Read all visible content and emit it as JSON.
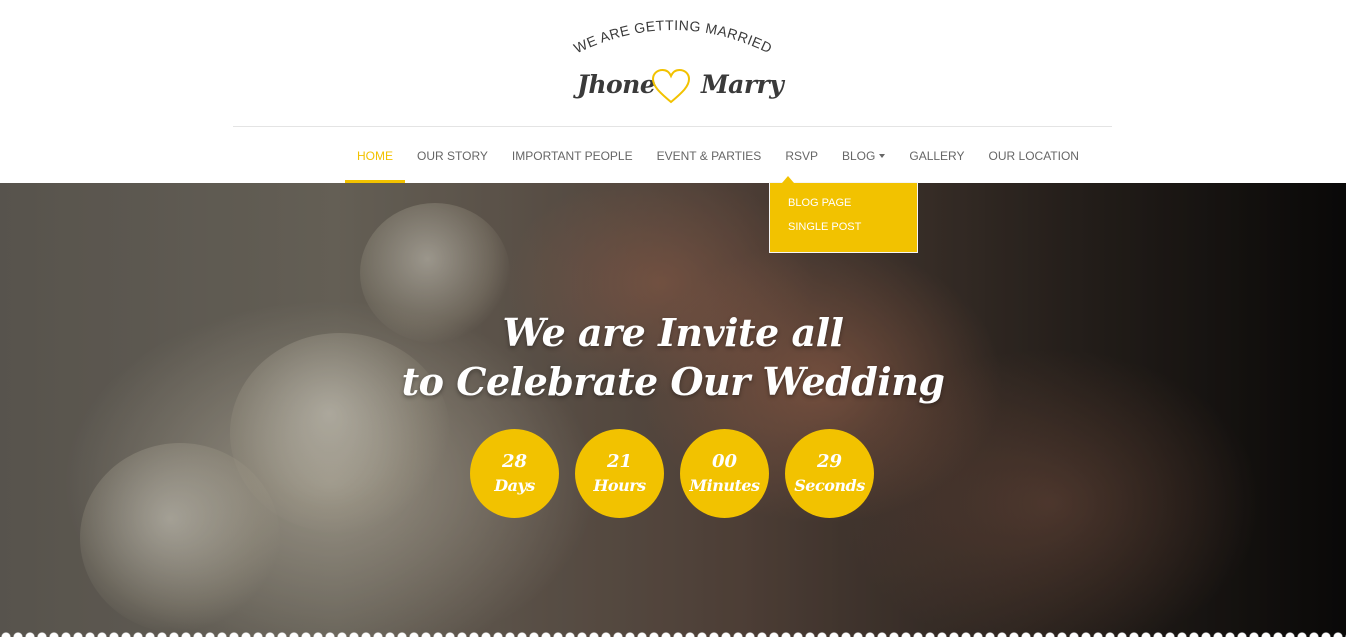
{
  "logo": {
    "tagline": "WE ARE GETTING MARRIED",
    "name_left": "Jhone",
    "name_right": "Marry",
    "heart_icon": "heart-outline-icon"
  },
  "nav": {
    "items": [
      {
        "label": "HOME",
        "active": true
      },
      {
        "label": "OUR STORY"
      },
      {
        "label": "IMPORTANT PEOPLE"
      },
      {
        "label": "EVENT & PARTIES"
      },
      {
        "label": "RSVP"
      },
      {
        "label": "BLOG",
        "has_dropdown": true
      },
      {
        "label": "GALLERY"
      },
      {
        "label": "OUR LOCATION"
      }
    ],
    "blog_dropdown": [
      "BLOG PAGE",
      "SINGLE POST"
    ]
  },
  "hero": {
    "headline_line1": "We are Invite all",
    "headline_line2": "to Celebrate Our Wedding",
    "countdown": [
      {
        "value": "28",
        "label": "Days"
      },
      {
        "value": "21",
        "label": "Hours"
      },
      {
        "value": "00",
        "label": "Minutes"
      },
      {
        "value": "29",
        "label": "Seconds"
      }
    ]
  },
  "colors": {
    "accent": "#f2c200",
    "nav_text": "#666666",
    "logo_text": "#3a3a3a"
  }
}
